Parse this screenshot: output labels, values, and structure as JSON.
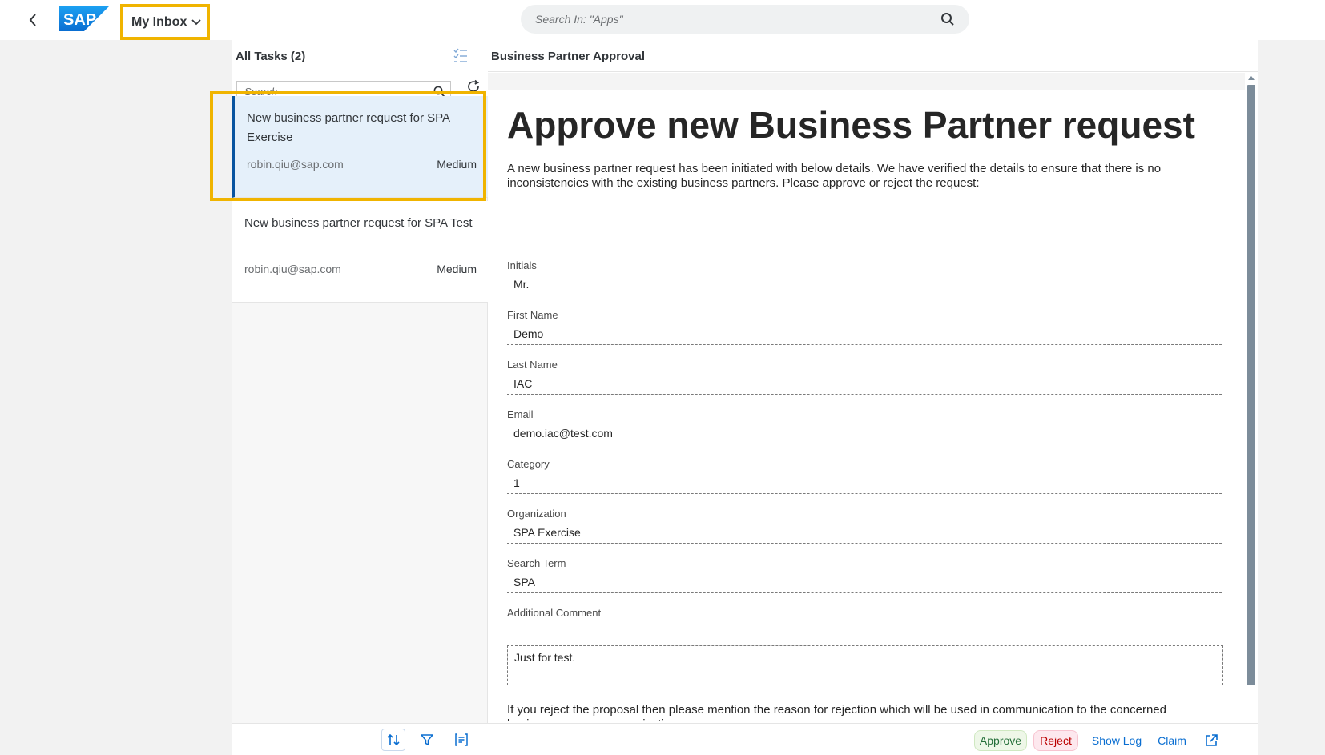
{
  "shell": {
    "back_icon": "chevron-left-icon",
    "logo_text": "SAP",
    "app_title": "My Inbox",
    "search_placeholder": "Search In: \"Apps\"",
    "colors": {
      "highlight": "#f0b400",
      "brand": "#0a6ed1"
    }
  },
  "master": {
    "title": "All Tasks (2)",
    "search_placeholder": "Search",
    "tasks": [
      {
        "title": "New business partner request for SPA Exercise",
        "sender": "robin.qiu@sap.com",
        "priority": "Medium",
        "selected": true
      },
      {
        "title": "New business partner request for SPA Test",
        "sender": "robin.qiu@sap.com",
        "priority": "Medium",
        "selected": false
      }
    ]
  },
  "detail": {
    "title": "Business Partner Approval",
    "heading": "Approve new Business Partner request",
    "intro": "A new business partner request has been initiated with below details. We have verified the details to ensure that there is no inconsistencies with the existing business partners. Please approve or reject the request:",
    "fields": [
      {
        "label": "Initials",
        "value": "Mr."
      },
      {
        "label": "First Name",
        "value": "Demo"
      },
      {
        "label": "Last Name",
        "value": "IAC"
      },
      {
        "label": "Email",
        "value": "demo.iac@test.com"
      },
      {
        "label": "Category",
        "value": "1"
      },
      {
        "label": "Organization",
        "value": "SPA Exercise"
      },
      {
        "label": "Search Term",
        "value": "SPA"
      }
    ],
    "comment_label": "Additional Comment",
    "comment_value": "Just for test.",
    "reject_note": "If you reject the proposal then please mention the reason for rejection which will be used in communication to the concerned business person or organization:"
  },
  "footer": {
    "approve": "Approve",
    "reject": "Reject",
    "show_log": "Show Log",
    "claim": "Claim"
  }
}
